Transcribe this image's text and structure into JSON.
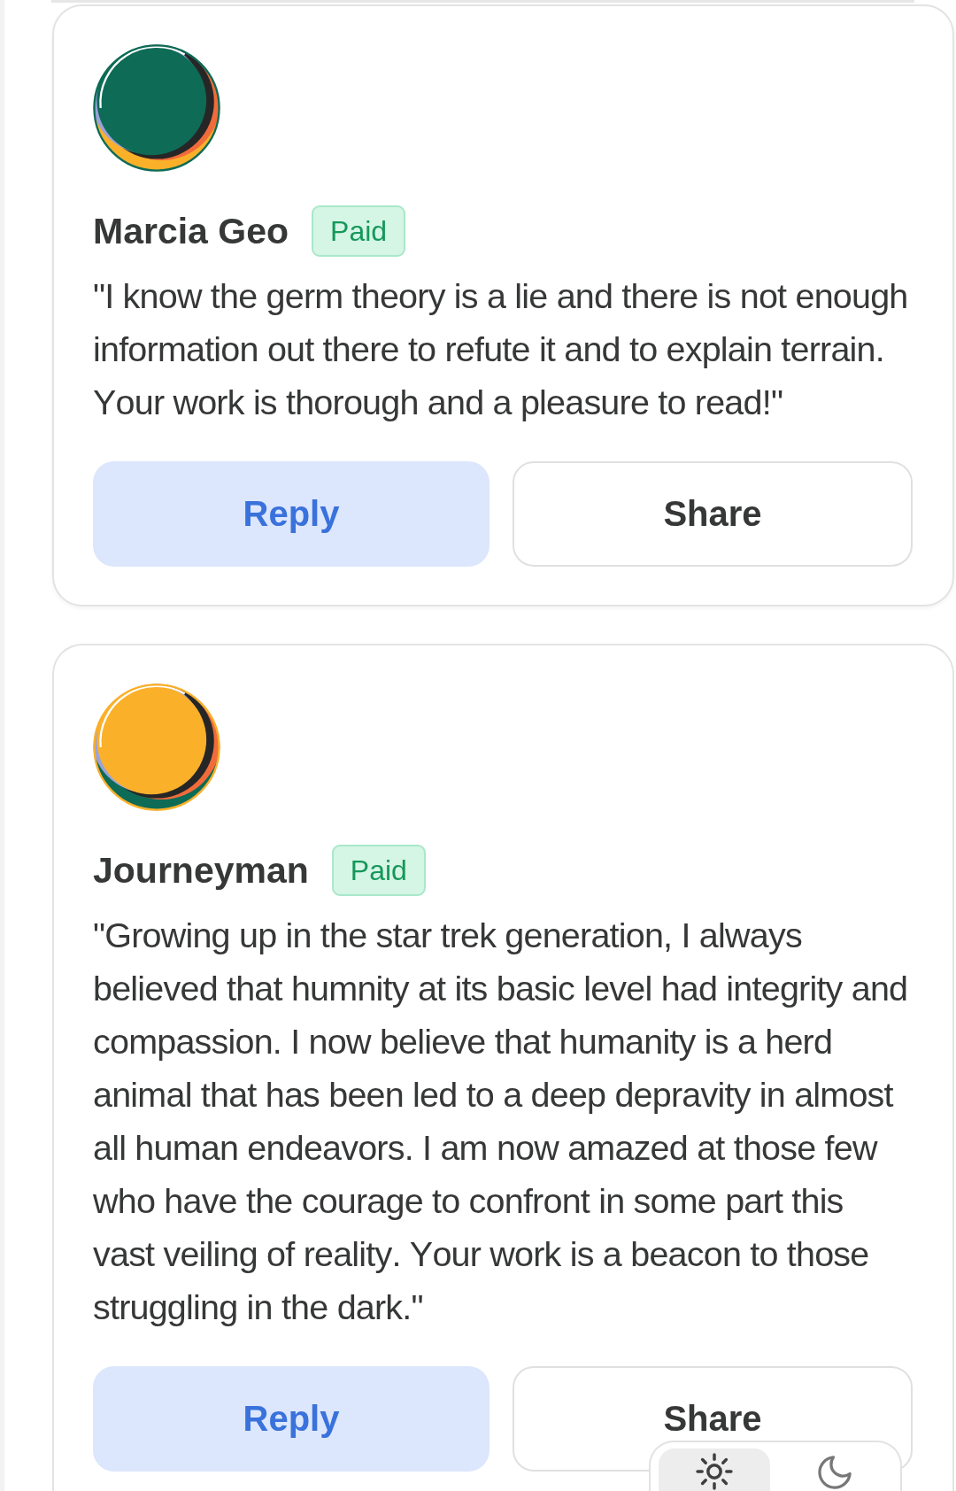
{
  "comments": [
    {
      "avatar": {
        "color": "#0d6b56",
        "band": {
          "color": "#fbb02a"
        }
      },
      "author": "Marcia Geo",
      "badge": "Paid",
      "text": "\"I know the germ theory is a lie and there is not enough information out there to refute it and to explain terrain. Your work is thorough and a pleasure to read!\"",
      "actions": [
        {
          "kind": "reply",
          "label": "Reply"
        },
        {
          "kind": "share",
          "label": "Share"
        }
      ]
    },
    {
      "avatar": {
        "color": "#fbb02a",
        "band": {
          "color": "#0d6b56"
        }
      },
      "author": "Journeyman",
      "badge": "Paid",
      "text": "\"Growing up in the star trek generation, I always believed that humnity at its basic level had integrity and compassion. I now believe that humanity is a herd animal that has been led to a deep depravity in almost all human endeavors. I am now amazed at those few who have the courage to confront in some part this vast veiling of reality. Your work is a beacon to those struggling in the dark.\"",
      "actions": [
        {
          "kind": "reply",
          "label": "Reply"
        },
        {
          "kind": "share",
          "label": "Share"
        }
      ]
    }
  ],
  "theme_toggle": {
    "options": [
      {
        "kind": "light",
        "selected": true
      },
      {
        "kind": "dark",
        "selected": false
      }
    ]
  }
}
